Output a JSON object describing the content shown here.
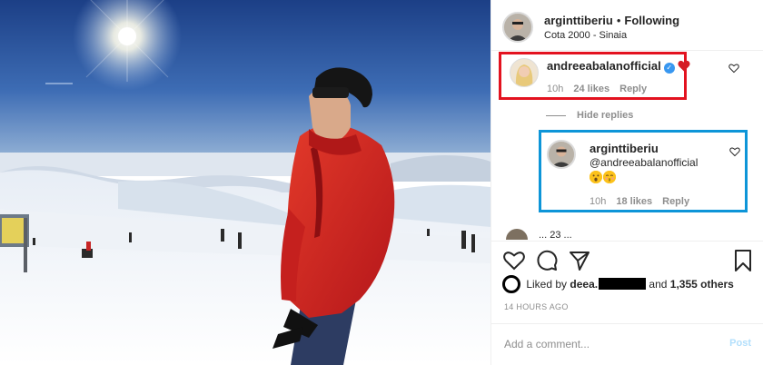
{
  "post": {
    "username": "arginttiberiu",
    "follow_status": "Following",
    "location": "Cota 2000 - Sinaia"
  },
  "comment": {
    "username": "andreeabalanofficial",
    "verified": true,
    "text_emoji": "red-heart",
    "time": "10h",
    "likes": "24 likes",
    "reply_label": "Reply",
    "highlight_color": "#e3121f"
  },
  "hide_replies": "Hide replies",
  "reply": {
    "username": "arginttiberiu",
    "mention": "@andreeabalanofficial",
    "emojis": [
      "face-with-open-mouth",
      "kissing-face-with-closed-eyes"
    ],
    "time": "10h",
    "likes": "18 likes",
    "reply_label": "Reply",
    "highlight_color": "#0d95d8"
  },
  "clipped_comment_text": "... 23 ... ",
  "likes": {
    "prefix": "Liked by",
    "user": "deea.",
    "joiner": "and",
    "others": "1,355 others"
  },
  "timestamp": "14 HOURS AGO",
  "composer": {
    "placeholder": "Add a comment...",
    "post_label": "Post"
  },
  "colors": {
    "link_blue": "#3897f0",
    "post_disabled": "#b2dffc",
    "meta_gray": "#8e8e8e"
  }
}
